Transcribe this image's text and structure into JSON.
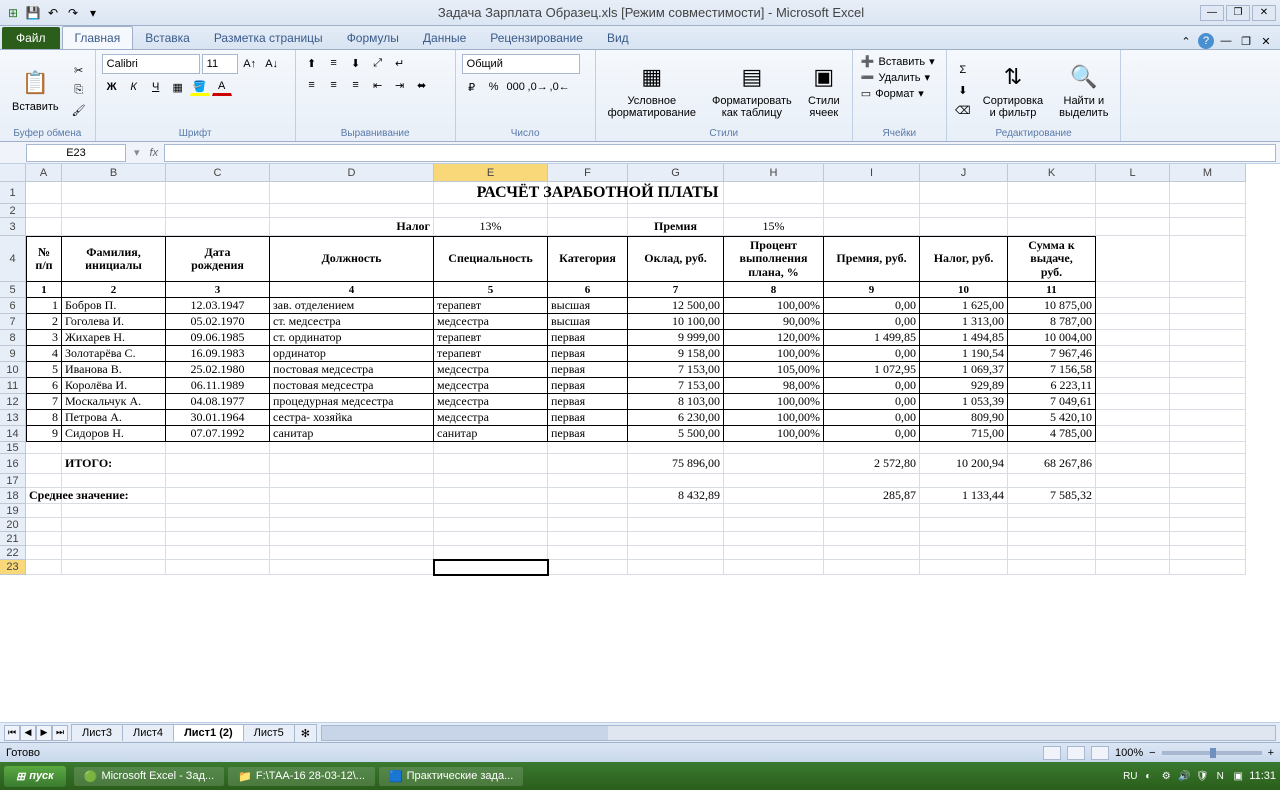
{
  "title": "Задача Зарплата Образец.xls  [Режим совместимости] - Microsoft Excel",
  "qat": {
    "excel": "X",
    "save": "💾",
    "undo": "↶",
    "redo": "↷"
  },
  "tabs": [
    "Главная",
    "Вставка",
    "Разметка страницы",
    "Формулы",
    "Данные",
    "Рецензирование",
    "Вид"
  ],
  "file_tab": "Файл",
  "ribbon": {
    "clipboard": {
      "paste": "Вставить",
      "label": "Буфер обмена"
    },
    "font": {
      "name": "Calibri",
      "size": "11",
      "label": "Шрифт"
    },
    "align": {
      "label": "Выравнивание"
    },
    "number": {
      "format": "Общий",
      "label": "Число"
    },
    "styles": {
      "cond": "Условное\nформатирование",
      "table": "Форматировать\nкак таблицу",
      "cell": "Стили\nячеек",
      "label": "Стили"
    },
    "cells": {
      "insert": "Вставить",
      "delete": "Удалить",
      "format": "Формат",
      "label": "Ячейки"
    },
    "editing": {
      "sort": "Сортировка\nи фильтр",
      "find": "Найти и\nвыделить",
      "label": "Редактирование"
    }
  },
  "name_box": "E23",
  "columns": [
    {
      "l": "A",
      "w": 36
    },
    {
      "l": "B",
      "w": 104
    },
    {
      "l": "C",
      "w": 104
    },
    {
      "l": "D",
      "w": 164
    },
    {
      "l": "E",
      "w": 114
    },
    {
      "l": "F",
      "w": 80
    },
    {
      "l": "G",
      "w": 96
    },
    {
      "l": "H",
      "w": 100
    },
    {
      "l": "I",
      "w": 96
    },
    {
      "l": "J",
      "w": 88
    },
    {
      "l": "K",
      "w": 88
    },
    {
      "l": "L",
      "w": 74
    },
    {
      "l": "M",
      "w": 76
    }
  ],
  "rows": [
    22,
    14,
    18,
    46,
    16,
    16,
    16,
    16,
    16,
    16,
    16,
    16,
    16,
    16,
    12,
    20,
    14,
    16,
    14,
    14,
    14,
    14,
    15
  ],
  "sheet_title": "РАСЧЁТ ЗАРАБОТНОЙ ПЛАТЫ",
  "row3": {
    "tax_lbl": "Налог",
    "tax_val": "13%",
    "bonus_lbl": "Премия",
    "bonus_val": "15%"
  },
  "headers": [
    "№\nп/п",
    "Фамилия,\nинициалы",
    "Дата\nрождения",
    "Должность",
    "Специальность",
    "Категория",
    "Оклад, руб.",
    "Процент\nвыполнения\nплана, %",
    "Премия, руб.",
    "Налог, руб.",
    "Сумма к\nвыдаче,\nруб."
  ],
  "headers2": [
    "1",
    "2",
    "3",
    "4",
    "5",
    "6",
    "7",
    "8",
    "9",
    "10",
    "11"
  ],
  "data_rows": [
    [
      "1",
      "Бобров П.",
      "12.03.1947",
      "зав. отделением",
      "терапевт",
      "высшая",
      "12 500,00",
      "100,00%",
      "0,00",
      "1 625,00",
      "10 875,00"
    ],
    [
      "2",
      "Гоголева И.",
      "05.02.1970",
      "ст. медсестра",
      "медсестра",
      "высшая",
      "10 100,00",
      "90,00%",
      "0,00",
      "1 313,00",
      "8 787,00"
    ],
    [
      "3",
      "Жихарев Н.",
      "09.06.1985",
      "ст. ординатор",
      "терапевт",
      "первая",
      "9 999,00",
      "120,00%",
      "1 499,85",
      "1 494,85",
      "10 004,00"
    ],
    [
      "4",
      "Золотарёва С.",
      "16.09.1983",
      "ординатор",
      "терапевт",
      "первая",
      "9 158,00",
      "100,00%",
      "0,00",
      "1 190,54",
      "7 967,46"
    ],
    [
      "5",
      "Иванова В.",
      "25.02.1980",
      "постовая медсестра",
      "медсестра",
      "первая",
      "7 153,00",
      "105,00%",
      "1 072,95",
      "1 069,37",
      "7 156,58"
    ],
    [
      "6",
      "Королёва И.",
      "06.11.1989",
      "постовая медсестра",
      "медсестра",
      "первая",
      "7 153,00",
      "98,00%",
      "0,00",
      "929,89",
      "6 223,11"
    ],
    [
      "7",
      "Москальчук А.",
      "04.08.1977",
      "процедурная медсестра",
      "медсестра",
      "первая",
      "8 103,00",
      "100,00%",
      "0,00",
      "1 053,39",
      "7 049,61"
    ],
    [
      "8",
      "Петрова А.",
      "30.01.1964",
      "сестра- хозяйка",
      "медсестра",
      "первая",
      "6 230,00",
      "100,00%",
      "0,00",
      "809,90",
      "5 420,10"
    ],
    [
      "9",
      "Сидоров Н.",
      "07.07.1992",
      "санитар",
      "санитар",
      "первая",
      "5 500,00",
      "100,00%",
      "0,00",
      "715,00",
      "4 785,00"
    ]
  ],
  "totals": {
    "label": "ИТОГО:",
    "oklad": "75 896,00",
    "premia": "2 572,80",
    "nalog": "10 200,94",
    "summa": "68 267,86"
  },
  "avg": {
    "label": "Среднее значение:",
    "oklad": "8 432,89",
    "premia": "285,87",
    "nalog": "1 133,44",
    "summa": "7 585,32"
  },
  "sheets": [
    "Лист3",
    "Лист4",
    "Лист1 (2)",
    "Лист5"
  ],
  "active_sheet": 2,
  "status": "Готово",
  "zoom": "100%",
  "taskbar": {
    "start": "пуск",
    "items": [
      "Microsoft Excel - Зад...",
      "F:\\ТАА-16 28-03-12\\...",
      "Практические зада..."
    ],
    "lang": "RU",
    "time": "11:31"
  }
}
